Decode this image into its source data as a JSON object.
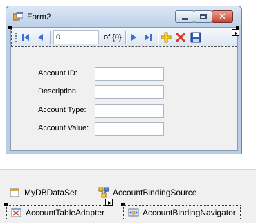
{
  "window": {
    "title": "Form2",
    "close_glyph": "✕"
  },
  "navigator": {
    "position_value": "0",
    "count_label": "of {0}",
    "icons": [
      "move-first-icon",
      "move-previous-icon",
      "move-next-icon",
      "move-last-icon",
      "add-new-icon",
      "delete-icon",
      "save-icon"
    ]
  },
  "fields": [
    {
      "label": "Account ID:",
      "value": ""
    },
    {
      "label": "Description:",
      "value": ""
    },
    {
      "label": "Account Type:",
      "value": ""
    },
    {
      "label": "Account Value:",
      "value": ""
    }
  ],
  "tray": {
    "dataset": "MyDBDataSet",
    "binding_source": "AccountBindingSource",
    "table_adapter": "AccountTableAdapter",
    "binding_navigator": "AccountBindingNavigator"
  },
  "colors": {
    "nav_blue": "#3b6fd6",
    "add_yellow": "#e8b400",
    "delete_red": "#d83b2b"
  }
}
